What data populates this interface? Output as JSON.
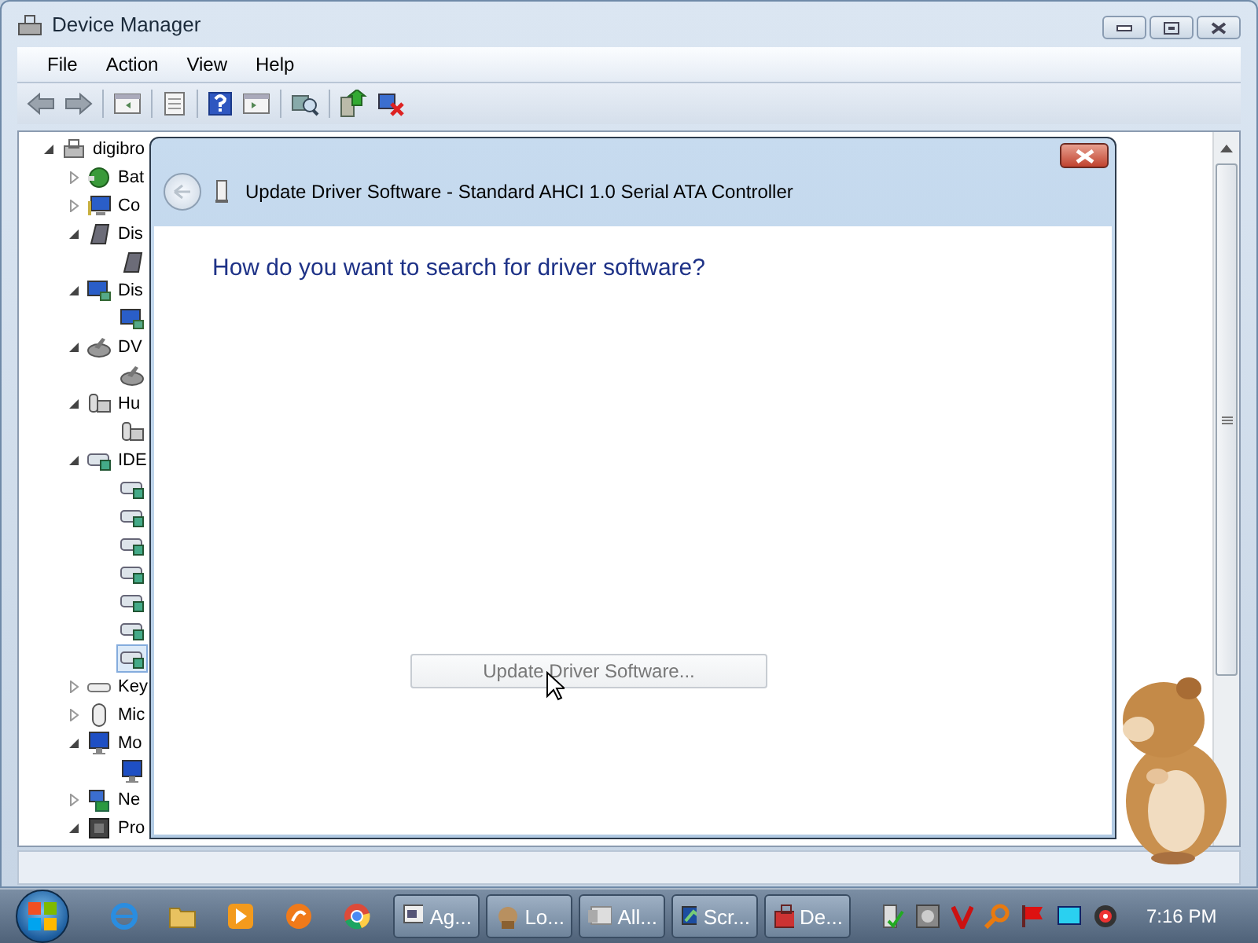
{
  "window": {
    "title": "Device Manager"
  },
  "menu": [
    "File",
    "Action",
    "View",
    "Help"
  ],
  "tree": {
    "label": "digibro",
    "expanded": true,
    "children": [
      {
        "label": "Bat",
        "expanded": false
      },
      {
        "label": "Co",
        "expanded": false
      },
      {
        "label": "Dis",
        "expanded": true,
        "children": [
          {
            "selected": false
          }
        ]
      },
      {
        "label": "Dis",
        "expanded": true,
        "children": [
          {
            "selected": false
          }
        ]
      },
      {
        "label": "DV",
        "expanded": true,
        "children": [
          {
            "selected": false
          }
        ]
      },
      {
        "label": "Hu",
        "expanded": true,
        "children": [
          {
            "selected": false
          }
        ]
      },
      {
        "label": "IDE",
        "expanded": true,
        "children": [
          {
            "selected": false
          },
          {
            "selected": false
          },
          {
            "selected": false
          },
          {
            "selected": false
          },
          {
            "selected": false
          },
          {
            "selected": false
          },
          {
            "selected": true
          }
        ]
      },
      {
        "label": "Key",
        "expanded": false
      },
      {
        "label": "Mic",
        "expanded": false
      },
      {
        "label": "Mo",
        "expanded": true,
        "children": [
          {
            "selected": false
          }
        ]
      },
      {
        "label": "Ne",
        "expanded": false
      },
      {
        "label": "Pro",
        "expanded": true
      }
    ]
  },
  "dialog": {
    "title": "Update Driver Software - Standard AHCI 1.0 Serial ATA Controller",
    "heading": "How do you want to search for driver software?",
    "button": {
      "label": "Update Driver Software...",
      "disabled": true
    }
  },
  "taskbar": {
    "tasks": [
      {
        "label": "Ag..."
      },
      {
        "label": "Lo..."
      },
      {
        "label": "All..."
      },
      {
        "label": "Scr..."
      },
      {
        "label": "De..."
      }
    ],
    "clock": "7:16 PM"
  }
}
